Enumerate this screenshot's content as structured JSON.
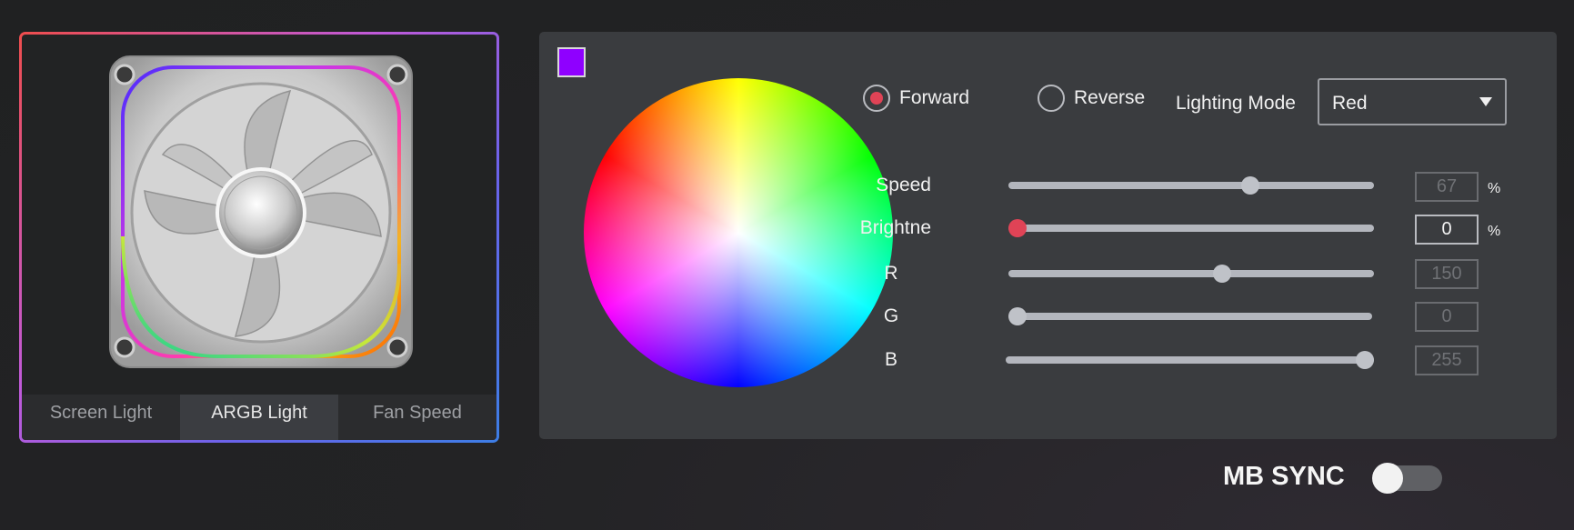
{
  "tabs": [
    {
      "label": "Screen Light",
      "active": false
    },
    {
      "label": "ARGB Light",
      "active": true
    },
    {
      "label": "Fan Speed",
      "active": false
    }
  ],
  "colors": {
    "swatch": "#8f00ff",
    "accent": "#e04356"
  },
  "direction": {
    "forward_label": "Forward",
    "reverse_label": "Reverse",
    "selected": "forward"
  },
  "lighting_mode": {
    "label": "Lighting Mode",
    "value": "Red"
  },
  "sliders": [
    {
      "key": "speed",
      "label": "Speed",
      "value": "67",
      "fraction": 0.67,
      "unit": "%",
      "active": false
    },
    {
      "key": "brightness",
      "label": "Brightne",
      "value": "0",
      "fraction": 0.0,
      "unit": "%",
      "active": true
    },
    {
      "key": "r",
      "label": "R",
      "value": "150",
      "fraction": 0.588,
      "unit": "",
      "active": false
    },
    {
      "key": "g",
      "label": "G",
      "value": "0",
      "fraction": 0.0,
      "unit": "",
      "active": false
    },
    {
      "key": "b",
      "label": "B",
      "value": "255",
      "fraction": 1.0,
      "unit": "",
      "active": false
    }
  ],
  "mb_sync": {
    "label": "MB SYNC",
    "enabled": false
  }
}
